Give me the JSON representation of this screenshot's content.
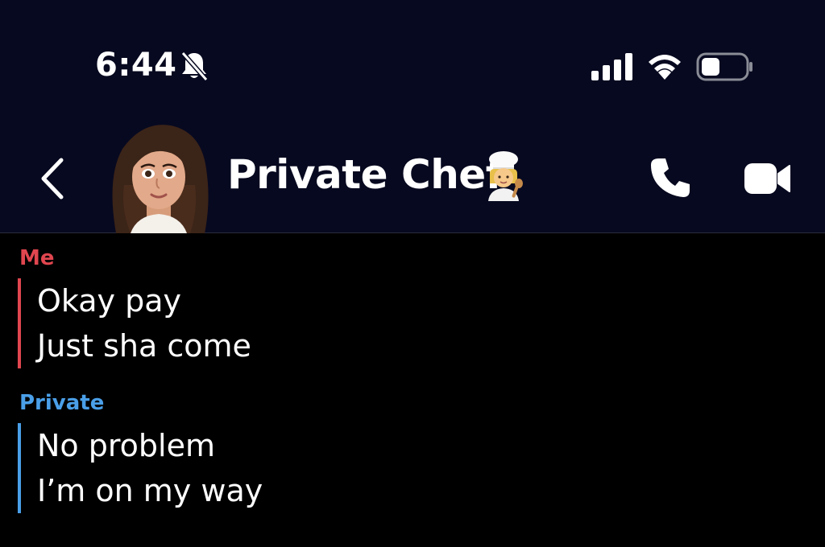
{
  "status_bar": {
    "time": "6:44",
    "icons": [
      "bell-slash-icon",
      "cellular-signal-icon",
      "wifi-icon",
      "battery-icon"
    ]
  },
  "header": {
    "title": "Private Chef",
    "title_emoji_icon": "chef-emoji-icon",
    "icons": [
      "back-chevron-icon",
      "phone-icon",
      "video-camera-icon"
    ]
  },
  "messages": [
    {
      "sender": "Me",
      "color": "#e0464f",
      "lines": [
        "Okay pay",
        "Just sha come"
      ]
    },
    {
      "sender": "Private",
      "color": "#4a9fe8",
      "lines": [
        "No problem",
        "I’m on my way"
      ]
    }
  ],
  "colors": {
    "header_bg": "#070920",
    "chat_bg": "#000000"
  }
}
